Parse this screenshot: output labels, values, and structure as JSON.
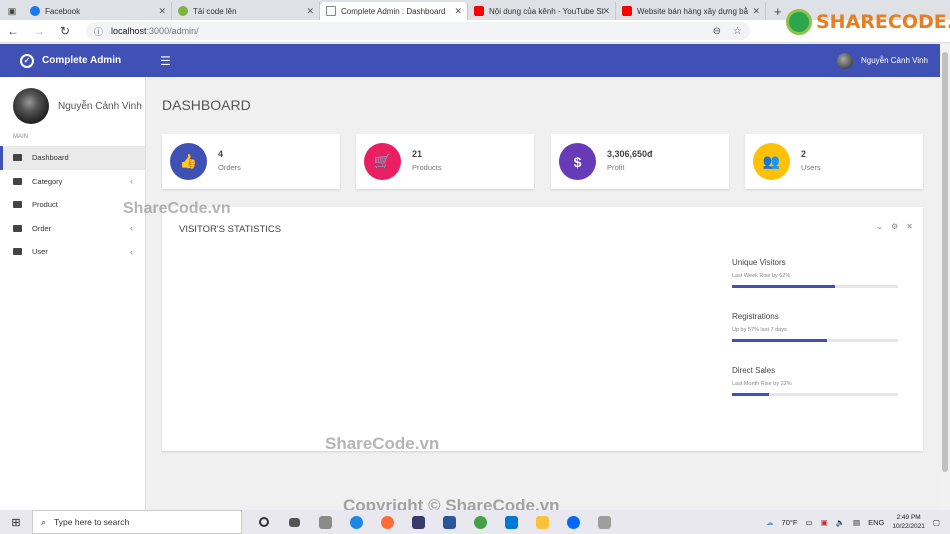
{
  "browser": {
    "tabs": [
      {
        "title": "Facebook",
        "color": "#1877f2",
        "active": false
      },
      {
        "title": "Tải code lên",
        "color": "#7cb342",
        "active": false
      },
      {
        "title": "Complete Admin : Dashboard",
        "color": "#ffffff",
        "active": true
      },
      {
        "title": "Nội dung của kênh - YouTube St",
        "color": "#ff0000",
        "active": false
      },
      {
        "title": "Website bán hàng xây dựng bằ",
        "color": "#ff0000",
        "active": false
      }
    ],
    "new_tab": "+",
    "url_host": "localhost",
    "url_path": ":3000/admin/"
  },
  "header": {
    "brand": "Complete Admin",
    "user_name": "Nguyễn Cảnh Vinh"
  },
  "sidebar": {
    "user_name": "Nguyễn Cảnh Vinh",
    "section": "MAIN",
    "items": [
      {
        "label": "Dashboard",
        "has_children": false
      },
      {
        "label": "Category",
        "has_children": true
      },
      {
        "label": "Product",
        "has_children": false
      },
      {
        "label": "Order",
        "has_children": true
      },
      {
        "label": "User",
        "has_children": true
      }
    ]
  },
  "main": {
    "title": "DASHBOARD",
    "cards": [
      {
        "value": "4",
        "label": "Orders",
        "color": "#3f51b5",
        "icon": "thumbs-up-icon"
      },
      {
        "value": "21",
        "label": "Products",
        "color": "#e91e63",
        "icon": "cart-icon"
      },
      {
        "value": "3,306,650đ",
        "label": "Profit",
        "color": "#673ab7",
        "icon": "dollar-icon"
      },
      {
        "value": "2",
        "label": "Users",
        "color": "#ffc107",
        "icon": "users-icon"
      }
    ],
    "panel": {
      "title": "VISITOR'S STATISTICS",
      "stats": [
        {
          "name": "Unique Visitors",
          "sub": "Last Week Rise by 62%",
          "progress": 0.62
        },
        {
          "name": "Registrations",
          "sub": "Up by 57% last 7 days",
          "progress": 0.57
        },
        {
          "name": "Direct Sales",
          "sub": "Last Month Rise by 22%",
          "progress": 0.22
        }
      ]
    }
  },
  "taskbar": {
    "search_placeholder": "Type here to search",
    "weather": "70°F",
    "language": "ENG",
    "time": "2:49 PM",
    "date": "10/22/2021"
  },
  "watermarks": {
    "logo": "SHARECODE.vn",
    "mid_left": "ShareCode.vn",
    "center": "ShareCode.vn",
    "bottom": "Copyright © ShareCode.vn"
  }
}
